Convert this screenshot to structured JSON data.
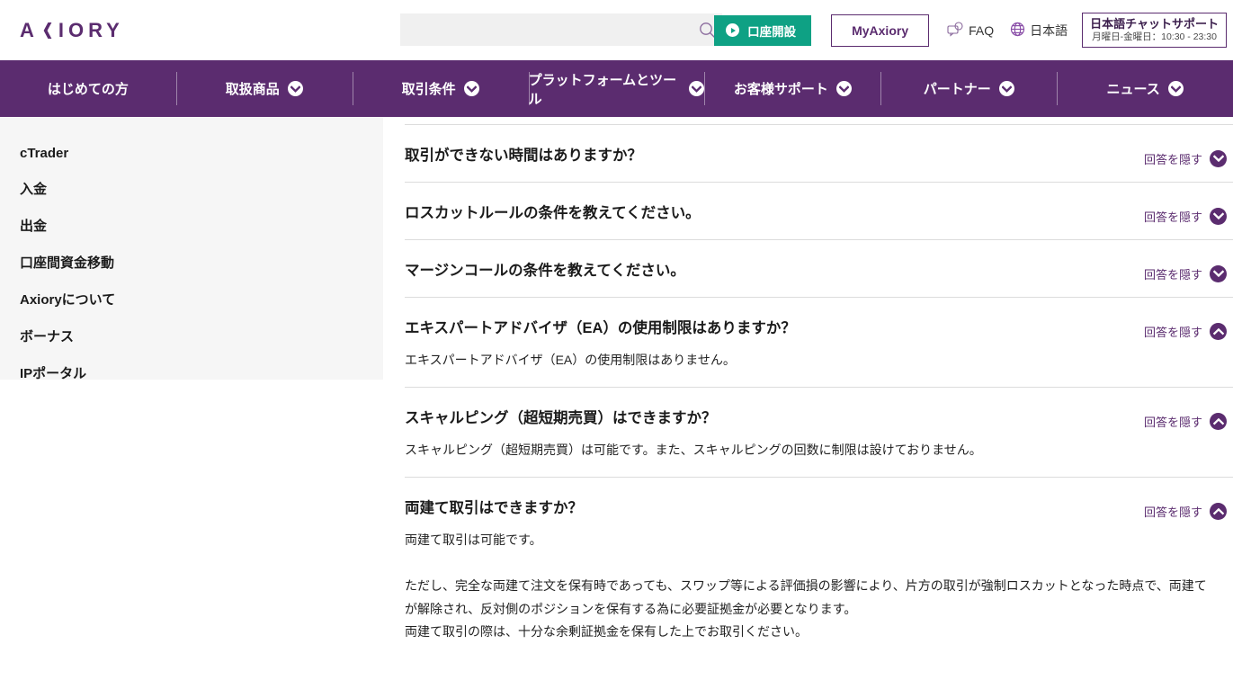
{
  "brand": {
    "name": "AXIORY",
    "color": "#5B2C6F"
  },
  "header": {
    "search": {
      "value": "",
      "placeholder": ""
    },
    "open_account_label": "口座開設",
    "myaxiory_label": "MyAxiory",
    "faq_label": "FAQ",
    "language_label": "日本語",
    "chat_support": {
      "title": "日本語チャットサポート",
      "hours": "月曜日-金曜日：10:30 - 23:30"
    }
  },
  "nav": {
    "items": [
      {
        "label": "はじめての方",
        "has_dropdown": false
      },
      {
        "label": "取扱商品",
        "has_dropdown": true
      },
      {
        "label": "取引条件",
        "has_dropdown": true
      },
      {
        "label": "プラットフォームとツール",
        "has_dropdown": true
      },
      {
        "label": "お客様サポート",
        "has_dropdown": true
      },
      {
        "label": "パートナー",
        "has_dropdown": true
      },
      {
        "label": "ニュース",
        "has_dropdown": true
      }
    ]
  },
  "sidebar": {
    "items": [
      {
        "label": "cTrader"
      },
      {
        "label": "入金"
      },
      {
        "label": "出金"
      },
      {
        "label": "口座間資金移動"
      },
      {
        "label": "Axioryについて"
      },
      {
        "label": "ボーナス"
      },
      {
        "label": "IPポータル"
      }
    ]
  },
  "faq": {
    "toggle_label": "回答を隠す",
    "items": [
      {
        "question": "取引ができない時間はありますか？",
        "expanded": false,
        "answer_paragraphs": []
      },
      {
        "question": "ロスカットルールの条件を教えてください。",
        "expanded": false,
        "answer_paragraphs": []
      },
      {
        "question": "マージンコールの条件を教えてください。",
        "expanded": false,
        "answer_paragraphs": []
      },
      {
        "question": "エキスパートアドバイザ（EA）の使用制限はありますか？",
        "expanded": true,
        "answer_paragraphs": [
          "エキスパートアドバイザ（EA）の使用制限はありません。"
        ]
      },
      {
        "question": "スキャルピング（超短期売買）はできますか？",
        "expanded": true,
        "answer_paragraphs": [
          "スキャルピング（超短期売買）は可能です。また、スキャルピングの回数に制限は設けておりません。"
        ]
      },
      {
        "question": "両建て取引はできますか？",
        "expanded": true,
        "answer_paragraphs": [
          "両建て取引は可能です。",
          "ただし、完全な両建て注文を保有時であっても、スワップ等による評価損の影響により、片方の取引が強制ロスカットとなった時点で、両建てが解除され、反対側のポジションを保有する為に必要証拠金が必要となります。\n両建て取引の際は、十分な余剰証拠金を保有した上でお取引ください。"
        ]
      }
    ]
  }
}
